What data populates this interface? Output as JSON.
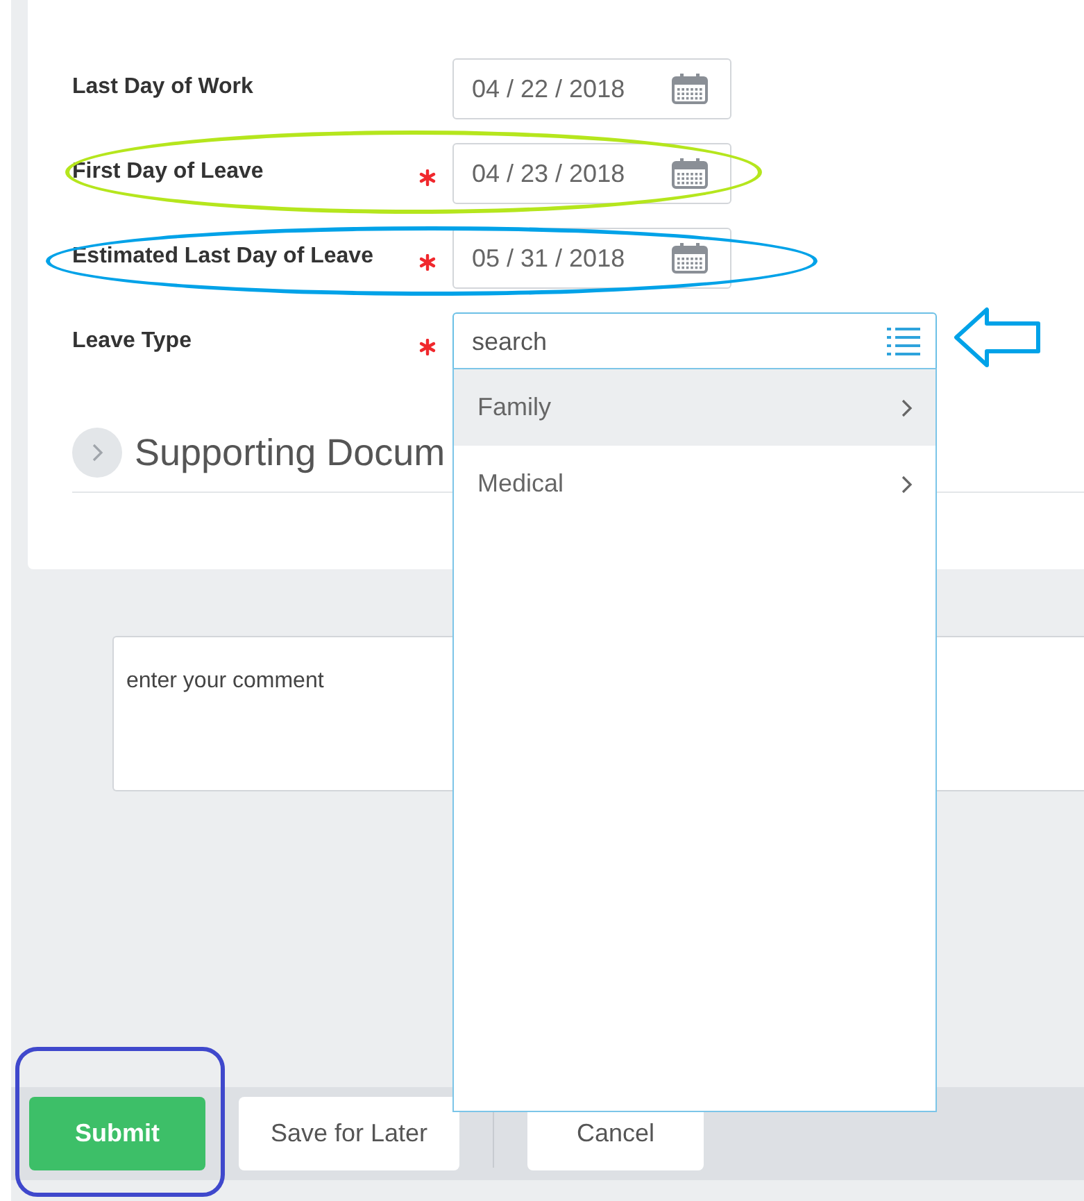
{
  "fields": [
    {
      "label": "Last Day of Work",
      "required": false,
      "kind": "date",
      "value": "04 / 22 / 2018"
    },
    {
      "label": "First Day of Leave",
      "required": true,
      "kind": "date",
      "value": "04 / 23 / 2018"
    },
    {
      "label": "Estimated Last Day of Leave",
      "required": true,
      "kind": "date",
      "value": "05 / 31 / 2018"
    },
    {
      "label": "Leave Type",
      "required": true,
      "kind": "prompt",
      "placeholder": "search"
    }
  ],
  "section": {
    "title": "Supporting Docum",
    "expanded": false
  },
  "dropdown": {
    "options": [
      {
        "label": "Family",
        "selected": true
      },
      {
        "label": "Medical",
        "selected": false
      }
    ]
  },
  "comment": {
    "placeholder": "enter your comment"
  },
  "buttons": [
    {
      "label": "Submit",
      "kind": "primary"
    },
    {
      "label": "Save for Later",
      "kind": "secondary"
    },
    {
      "label": "Cancel",
      "kind": "secondary"
    }
  ],
  "annotations": [
    {
      "kind": "ellipse",
      "color": "#b5e61d"
    },
    {
      "kind": "ellipse",
      "color": "#00a2e8"
    },
    {
      "kind": "arrow",
      "color": "#00a2e8"
    },
    {
      "kind": "box",
      "color": "#3f48cc"
    }
  ]
}
